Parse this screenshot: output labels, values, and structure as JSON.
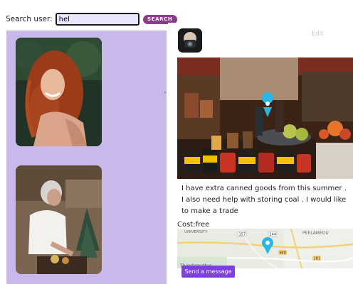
{
  "search": {
    "label": "Search user:",
    "value": "hel",
    "button_label": "SEARCH"
  },
  "users": [
    {
      "name_icon": "user-photo-curly-hair-woman"
    },
    {
      "name_icon": "user-photo-woman-cooking"
    }
  ],
  "post": {
    "edit_label": "Edit",
    "description": "I have extra canned goods from this summer . I also need help with storing coal . I would like to make a trade",
    "cost": "Cost:free",
    "map_labels": {
      "top_left": "UNIVERSITY",
      "bottom_left": "Thondamuthur",
      "top_right": "PEELAMEDU",
      "road_a": "157",
      "road_b": "144",
      "road_c": "948",
      "road_d": "181"
    },
    "send_label": "Send a message"
  },
  "colors": {
    "panel_bg": "#c9b8ec",
    "search_button": "#8a3e8a",
    "send_button": "#7e3fe0",
    "map_pin": "#29b6e6"
  }
}
